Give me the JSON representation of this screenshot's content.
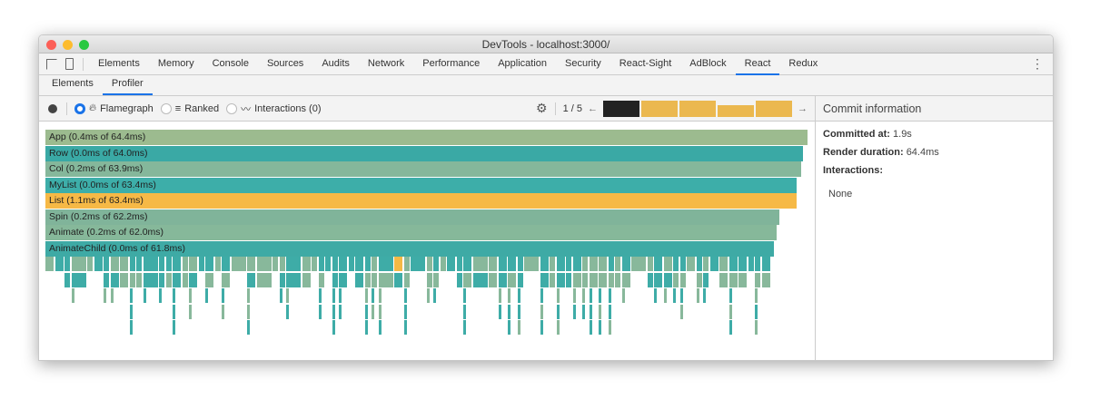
{
  "window": {
    "title": "DevTools - localhost:3000/"
  },
  "tabs": [
    "Elements",
    "Memory",
    "Console",
    "Sources",
    "Audits",
    "Network",
    "Performance",
    "Application",
    "Security",
    "React-Sight",
    "AdBlock",
    "React",
    "Redux"
  ],
  "active_tab": "React",
  "subtabs": [
    "Elements",
    "Profiler"
  ],
  "active_subtab": "Profiler",
  "toolbar": {
    "flamegraph": "Flamegraph",
    "ranked": "Ranked",
    "interactions": "Interactions (0)",
    "selected_view": "Flamegraph",
    "commit_counter": "1 / 5"
  },
  "commits": {
    "selected": 0,
    "values": [
      1.0,
      1.0,
      1.0,
      0.7,
      1.0
    ]
  },
  "colors": {
    "teal": "#3eaca7",
    "sage": "#88b89b",
    "yellow": "#f5b945",
    "app": "#9cbb8f",
    "selected_commit": "#222222",
    "commit": "#ebb84f"
  },
  "flamegraph": [
    {
      "label": "App (0.4ms of 64.4ms)",
      "fraction": 1.0,
      "color": "#9cbb8f"
    },
    {
      "label": "Row (0.0ms of 64.0ms)",
      "fraction": 0.994,
      "color": "#3aa9a5"
    },
    {
      "label": "Col (0.2ms of 63.9ms)",
      "fraction": 0.992,
      "color": "#85b79b"
    },
    {
      "label": "MyList (0.0ms of 63.4ms)",
      "fraction": 0.986,
      "color": "#3daea9"
    },
    {
      "label": "List (1.1ms of 63.4ms)",
      "fraction": 0.986,
      "color": "#f6b946"
    },
    {
      "label": "Spin (0.2ms of 62.2ms)",
      "fraction": 0.963,
      "color": "#80b49a"
    },
    {
      "label": "Animate (0.2ms of 62.0ms)",
      "fraction": 0.96,
      "color": "#86b89a"
    },
    {
      "label": "AnimateChild (0.0ms of 61.8ms)",
      "fraction": 0.956,
      "color": "#3eaaa5"
    }
  ],
  "commit_info": {
    "title": "Commit information",
    "committed_at_label": "Committed at:",
    "committed_at": "1.9s",
    "render_duration_label": "Render duration:",
    "render_duration": "64.4ms",
    "interactions_label": "Interactions:",
    "interactions": "None"
  }
}
